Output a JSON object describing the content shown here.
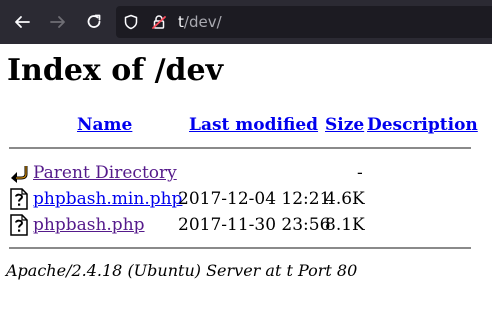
{
  "browser": {
    "url_host": "t",
    "url_path": "/dev/"
  },
  "page": {
    "title": "Index of /dev",
    "columns": {
      "name": "Name",
      "last_modified": "Last modified",
      "size": "Size",
      "description": "Description"
    },
    "rows": [
      {
        "name": "Parent Directory",
        "last_modified": "",
        "size": "-",
        "description": "",
        "icon": "back-arrow-icon"
      },
      {
        "name": "phpbash.min.php",
        "last_modified": "2017-12-04 12:21",
        "size": "4.6K",
        "description": "",
        "icon": "unknown-file-icon"
      },
      {
        "name": "phpbash.php",
        "last_modified": "2017-11-30 23:56",
        "size": "8.1K",
        "description": "",
        "icon": "unknown-file-icon"
      }
    ],
    "footer": "Apache/2.4.18 (Ubuntu) Server at t Port 80"
  },
  "colors": {
    "toolbar_bg": "#2b2a33",
    "urlbar_bg": "#1c1b22",
    "link": "#0000ee",
    "visited_link": "#551a8b"
  }
}
